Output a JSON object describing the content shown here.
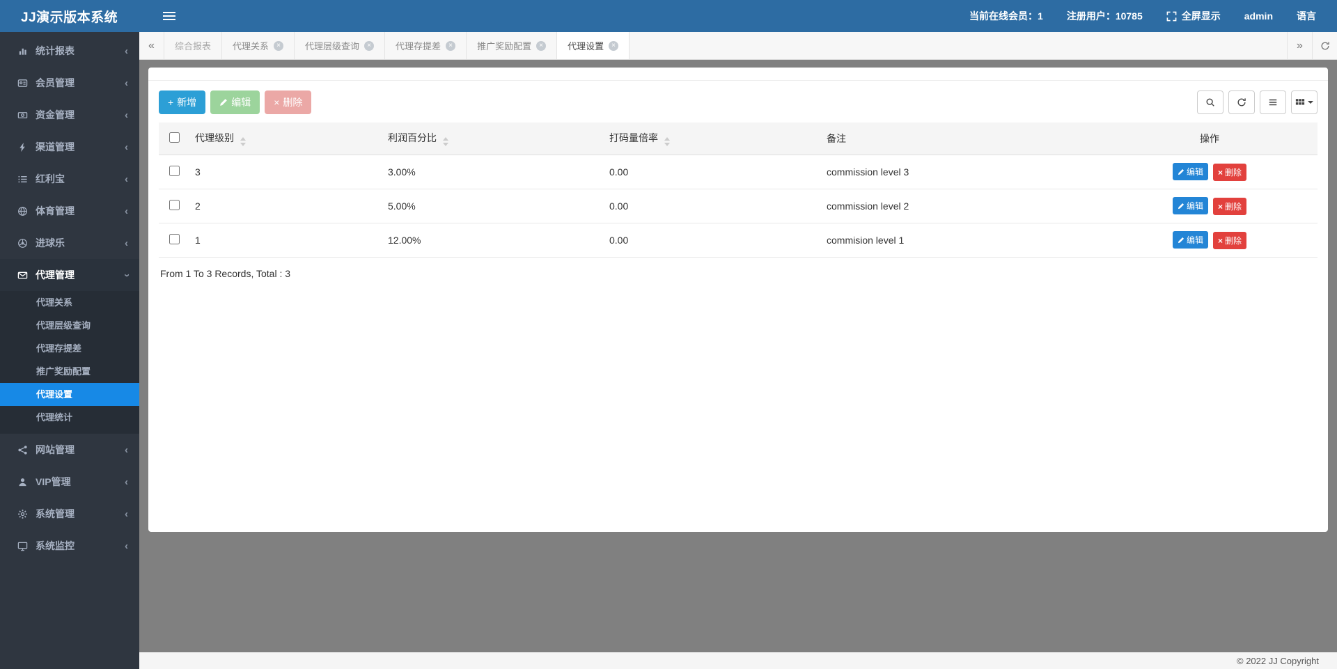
{
  "app": {
    "brand": "JJ演示版本系统"
  },
  "colors": {
    "header_blue": "#2d6ca3",
    "sidebar_dark": "#2f3640",
    "active_blue": "#1789e6",
    "add_button_blue": "#2c9fd6",
    "edit_button_green": "#5cb85c",
    "delete_button_red": "#d9534f",
    "row_edit_blue": "#2385d6",
    "row_delete_red": "#e2413d",
    "content_background": "#808080"
  },
  "topbar": {
    "online": "当前在线会员：1",
    "registered": "注册用户：10785",
    "fullscreen": "全屏显示",
    "username": "admin",
    "language": "语言"
  },
  "sidebar": {
    "items": [
      {
        "label": "统计报表",
        "icon": "bar-chart-icon"
      },
      {
        "label": "会员管理",
        "icon": "id-card-icon"
      },
      {
        "label": "资金管理",
        "icon": "banknote-icon"
      },
      {
        "label": "渠道管理",
        "icon": "bolt-icon"
      },
      {
        "label": "红利宝",
        "icon": "list-icon"
      },
      {
        "label": "体育管理",
        "icon": "globe-icon"
      },
      {
        "label": "进球乐",
        "icon": "soccer-ball-icon"
      },
      {
        "label": "代理管理",
        "icon": "envelope-icon"
      },
      {
        "label": "网站管理",
        "icon": "share-nodes-icon"
      },
      {
        "label": "VIP管理",
        "icon": "user-icon"
      },
      {
        "label": "系统管理",
        "icon": "gear-icon"
      },
      {
        "label": "系统监控",
        "icon": "monitor-icon"
      }
    ],
    "agent_submenu": [
      {
        "label": "代理关系"
      },
      {
        "label": "代理层级查询"
      },
      {
        "label": "代理存提差"
      },
      {
        "label": "推广奖励配置"
      },
      {
        "label": "代理设置",
        "active": true
      },
      {
        "label": "代理统计"
      }
    ]
  },
  "tabbar": {
    "tabs": [
      {
        "label": "综合报表",
        "closable": false
      },
      {
        "label": "代理关系",
        "closable": true
      },
      {
        "label": "代理层级查询",
        "closable": true
      },
      {
        "label": "代理存提差",
        "closable": true
      },
      {
        "label": "推广奖励配置",
        "closable": true
      },
      {
        "label": "代理设置",
        "closable": true,
        "active": true
      }
    ]
  },
  "toolbar": {
    "add_label": "新增",
    "edit_label": "编辑",
    "delete_label": "删除"
  },
  "table": {
    "columns": {
      "level": "代理级别",
      "profit": "利润百分比",
      "wager": "打码量倍率",
      "remark": "备注",
      "ops": "操作"
    },
    "rows": [
      {
        "level": "3",
        "profit": "3.00%",
        "wager": "0.00",
        "remark": "commission level 3"
      },
      {
        "level": "2",
        "profit": "5.00%",
        "wager": "0.00",
        "remark": "commission level 2"
      },
      {
        "level": "1",
        "profit": "12.00%",
        "wager": "0.00",
        "remark": "commision level 1"
      }
    ],
    "actions": {
      "edit": "编辑",
      "delete": "删除"
    },
    "summary": "From 1 To 3 Records, Total : 3"
  },
  "footer": {
    "copyright": "© 2022 JJ Copyright"
  }
}
